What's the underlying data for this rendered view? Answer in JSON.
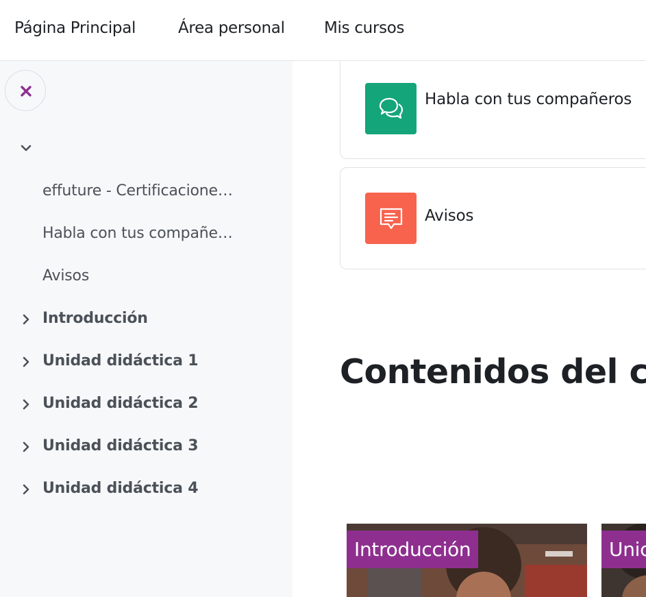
{
  "topnav": {
    "links": [
      "Página Principal",
      "Área personal",
      "Mis cursos"
    ]
  },
  "drawer": {
    "close_icon": "close-icon",
    "items": [
      {
        "label": "effuture - Certificacione…",
        "bold": false
      },
      {
        "label": "Habla con tus compañe…",
        "bold": false
      },
      {
        "label": "Avisos",
        "bold": false
      }
    ],
    "sections": [
      {
        "label": "Introducción"
      },
      {
        "label": "Unidad didáctica 1"
      },
      {
        "label": "Unidad didáctica 2"
      },
      {
        "label": "Unidad didáctica 3"
      },
      {
        "label": "Unidad didáctica 4"
      }
    ]
  },
  "main": {
    "activities": [
      {
        "label": "Habla con tus compañeros",
        "icon": "forum-icon",
        "color": "#15a57a"
      },
      {
        "label": "Avisos",
        "icon": "announcement-icon",
        "color": "#f7634d"
      }
    ],
    "contents_title": "Contenidos del cu",
    "tiles": [
      {
        "tag": "Introducción",
        "tag_color": "#8e2f8f"
      },
      {
        "tag": "Unic",
        "tag_color": "#8e2f8f"
      }
    ]
  },
  "colors": {
    "accent": "#8e2f8f",
    "drawer_bg": "#f7f8fa",
    "forum": "#15a57a",
    "announcement": "#f7634d"
  }
}
